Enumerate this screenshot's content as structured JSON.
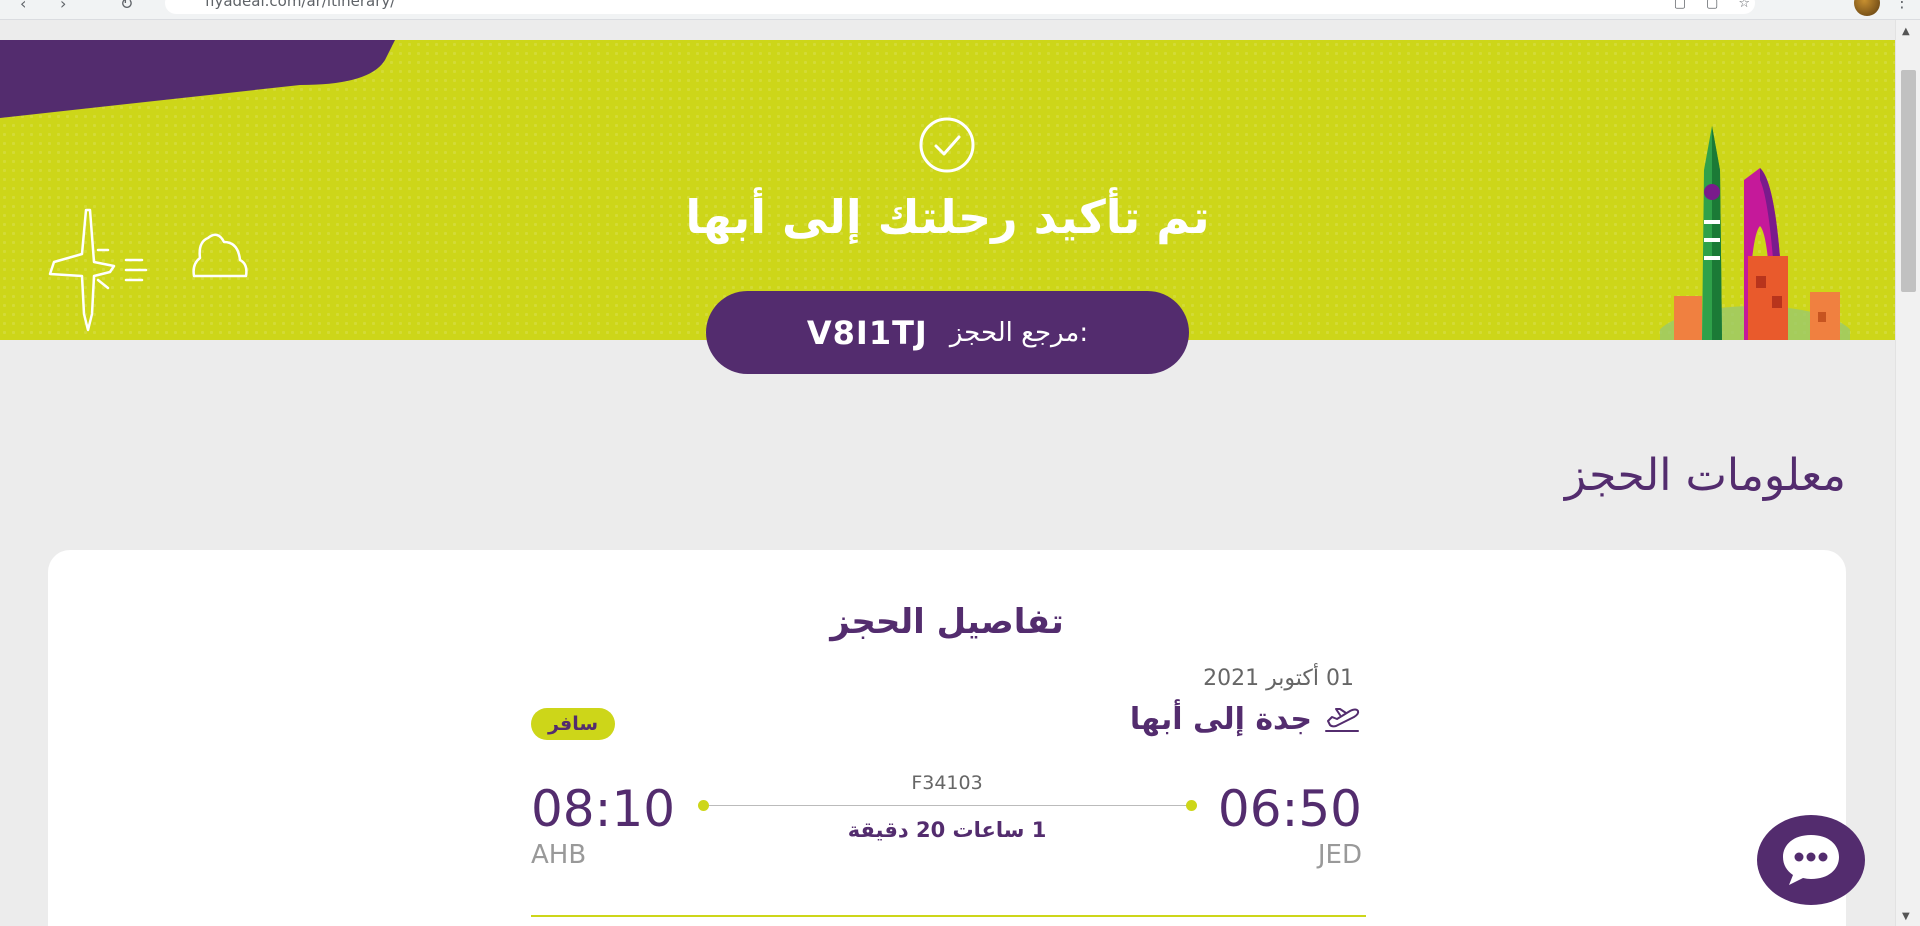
{
  "browser": {
    "url": "flyadeal.com/ar/itinerary/"
  },
  "hero": {
    "title": "تم تأكيد رحلتك إلى أبها",
    "reference_label": "مرجع الحجز:",
    "reference_code": "V8I1TJ"
  },
  "section": {
    "title": "معلومات الحجز"
  },
  "booking": {
    "card_title": "تفاصيل الحجز",
    "date": "01 أكتوبر 2021",
    "route": "جدة إلى أبها",
    "status_badge": "سافر",
    "flight_number": "F34103",
    "duration": "1 ساعات 20 دقيقة",
    "departure": {
      "time": "06:50",
      "code": "JED"
    },
    "arrival": {
      "time": "08:10",
      "code": "AHB"
    }
  },
  "colors": {
    "brand_purple": "#532c6e",
    "brand_lime": "#cdd619",
    "page_bg": "#ececec"
  },
  "icons": {
    "hero_check": "check-circle-icon",
    "plane": "plane-icon",
    "cloud": "cloud-icon",
    "takeoff": "plane-takeoff-icon",
    "chat": "chat-bubble-icon"
  }
}
